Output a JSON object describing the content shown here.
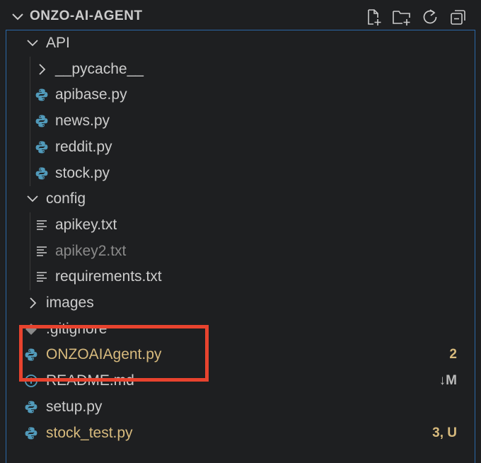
{
  "header": {
    "title": "ONZO-AI-AGENT",
    "actions": [
      {
        "name": "new-file-icon",
        "label": "New File"
      },
      {
        "name": "new-folder-icon",
        "label": "New Folder"
      },
      {
        "name": "refresh-icon",
        "label": "Refresh"
      },
      {
        "name": "collapse-all-icon",
        "label": "Collapse All"
      }
    ]
  },
  "tree": [
    {
      "label": "API",
      "type": "folder",
      "expanded": true,
      "depth": 1
    },
    {
      "label": "__pycache__",
      "type": "folder",
      "expanded": false,
      "depth": 2
    },
    {
      "label": "apibase.py",
      "type": "python",
      "depth": 2
    },
    {
      "label": "news.py",
      "type": "python",
      "depth": 2
    },
    {
      "label": "reddit.py",
      "type": "python",
      "depth": 2
    },
    {
      "label": "stock.py",
      "type": "python",
      "depth": 2
    },
    {
      "label": "config",
      "type": "folder",
      "expanded": true,
      "depth": 1
    },
    {
      "label": "apikey.txt",
      "type": "text",
      "depth": 2
    },
    {
      "label": "apikey2.txt",
      "type": "text",
      "depth": 2,
      "dimmed": true
    },
    {
      "label": "requirements.txt",
      "type": "text",
      "depth": 2
    },
    {
      "label": "images",
      "type": "folder",
      "expanded": false,
      "depth": 1
    },
    {
      "label": ".gitignore",
      "type": "git",
      "depth": 1
    },
    {
      "label": "ONZOAIAgent.py",
      "type": "python",
      "depth": 1,
      "status": "modified",
      "badge": "2"
    },
    {
      "label": "README.md",
      "type": "info",
      "depth": 1,
      "badge": "↓M"
    },
    {
      "label": "setup.py",
      "type": "python",
      "depth": 1
    },
    {
      "label": "stock_test.py",
      "type": "python",
      "depth": 1,
      "status": "modified",
      "badge": "3, U"
    }
  ],
  "colors": {
    "background": "#1e1f21",
    "text": "#cccccc",
    "modified": "#d7ba7d",
    "dimmed": "#8a8a8a",
    "focus_border": "#2a67a8",
    "annotation": "#e8432e",
    "python_blue": "#519aba"
  }
}
